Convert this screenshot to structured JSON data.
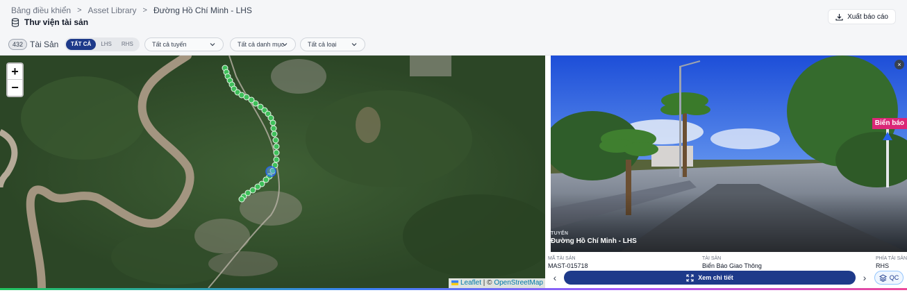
{
  "breadcrumb": [
    "Bảng điều khiển",
    "Asset Library",
    "Đường Hồ Chí Minh - LHS"
  ],
  "page_title": "Thư viện tài sản",
  "export_label": "Xuất báo cáo",
  "toolbar": {
    "count": "432",
    "count_label": "Tài Sản",
    "segments": [
      "TẤT CẢ",
      "LHS",
      "RHS"
    ],
    "active_segment": "TẤT CẢ",
    "filters": [
      "Tất cả tuyến",
      "Tất cả danh mục",
      "Tất cả loại"
    ]
  },
  "map": {
    "zoom_in": "+",
    "zoom_out": "−",
    "attribution": {
      "leaflet": "Leaflet",
      "sep": " | © ",
      "osm": "OpenStreetMap"
    }
  },
  "panel": {
    "caption_label": "TUYẾN",
    "caption_value": "Đường Hồ Chí Minh - LHS",
    "tag": "Biển báo",
    "close": "×",
    "info": [
      {
        "label": "MÃ TÀI SẢN",
        "value": "MAST-015718"
      },
      {
        "label": "TÀI SẢN",
        "value": "Biển Báo Giao Thông"
      },
      {
        "label": "PHÍA TÀI SẢN",
        "value": "RHS"
      }
    ],
    "prev": "‹",
    "next": "›",
    "detail_label": "Xem chi tiết",
    "qc_label": "QC"
  },
  "colors": {
    "accent": "#1e3a8a",
    "marker": "#22c55e",
    "tag": "#db2777"
  }
}
